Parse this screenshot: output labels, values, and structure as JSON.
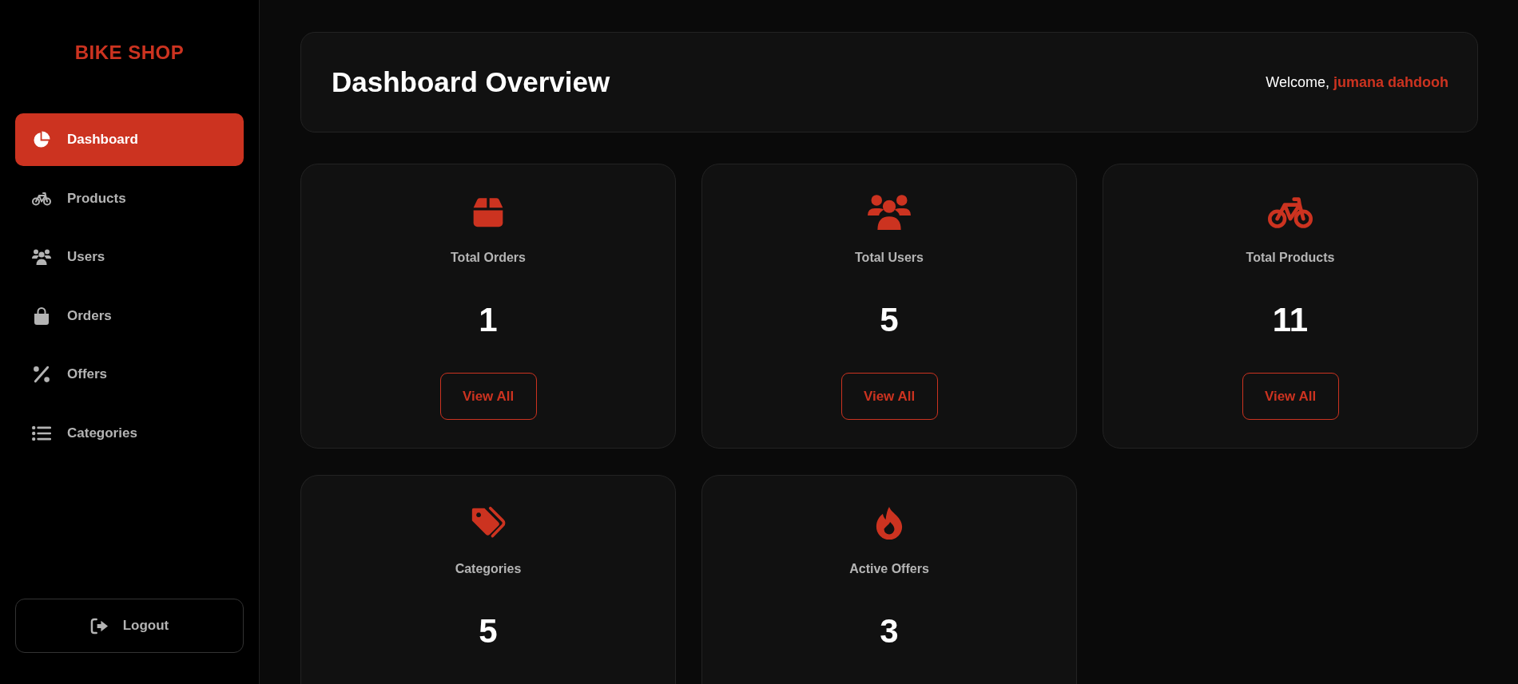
{
  "sidebar": {
    "brand": "BIKE SHOP",
    "items": [
      {
        "label": "Dashboard",
        "selected": true
      },
      {
        "label": "Products",
        "selected": false
      },
      {
        "label": "Users",
        "selected": false
      },
      {
        "label": "Orders",
        "selected": false
      },
      {
        "label": "Offers",
        "selected": false
      },
      {
        "label": "Categories",
        "selected": false
      }
    ],
    "logout": "Logout"
  },
  "header": {
    "title": "Dashboard Overview",
    "greeting": "Welcome,",
    "user_name": "jumana dahdooh"
  },
  "cards": [
    {
      "label": "Total Orders",
      "value": "1",
      "button": "View All"
    },
    {
      "label": "Total Users",
      "value": "5",
      "button": "View All"
    },
    {
      "label": "Total Products",
      "value": "11",
      "button": "View All"
    },
    {
      "label": "Categories",
      "value": "5"
    },
    {
      "label": "Active Offers",
      "value": "3"
    }
  ]
}
